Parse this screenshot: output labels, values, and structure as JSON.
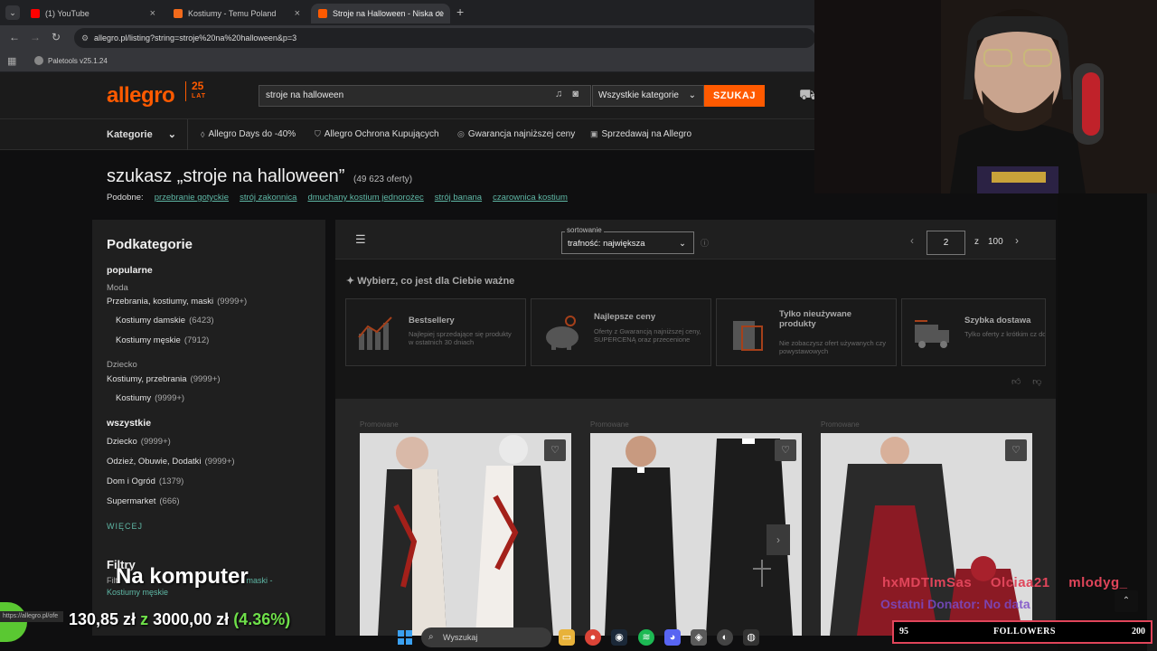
{
  "browser": {
    "tabs": [
      {
        "label": "(1) YouTube"
      },
      {
        "label": "Kostiumy - Temu Poland"
      },
      {
        "label": "Stroje na Halloween - Niska ce"
      }
    ],
    "url": "allegro.pl/listing?string=stroje%20na%20halloween&p=3",
    "bookmark": "Paletools v25.1.24"
  },
  "header": {
    "logo": "allegro",
    "logo_badge_num": "25",
    "logo_badge_text": "LAT",
    "search_value": "stroje na halloween",
    "category": "Wszystkie kategorie",
    "search_button": "SZUKAJ"
  },
  "subnav": {
    "categories": "Kategorie",
    "links": [
      "Allegro Days do -40%",
      "Allegro Ochrona Kupujących",
      "Gwarancja najniższej ceny",
      "Sprzedawaj na Allegro"
    ]
  },
  "listing": {
    "title": "szukasz „stroje na halloween”",
    "count": "(49 623 oferty)",
    "similar_label": "Podobne:",
    "similar": [
      "przebranie gotyckie",
      "strój zakonnica",
      "dmuchany kostium jednorożec",
      "strój banana",
      "czarownica kostium"
    ]
  },
  "sidebar": {
    "title": "Podkategorie",
    "popular": "popularne",
    "group1": "Moda",
    "item1": {
      "label": "Przebrania, kostiumy, maski",
      "count": "(9999+)"
    },
    "item1a": {
      "label": "Kostiumy damskie",
      "count": "(6423)"
    },
    "item1b": {
      "label": "Kostiumy męskie",
      "count": "(7912)"
    },
    "group2": "Dziecko",
    "item2": {
      "label": "Kostiumy, przebrania",
      "count": "(9999+)"
    },
    "item2a": {
      "label": "Kostiumy",
      "count": "(9999+)"
    },
    "all": "wszystkie",
    "all_items": [
      {
        "label": "Dziecko",
        "count": "(9999+)"
      },
      {
        "label": "Odzież, Obuwie, Dodatki",
        "count": "(9999+)"
      },
      {
        "label": "Dom i Ogród",
        "count": "(1379)"
      },
      {
        "label": "Supermarket",
        "count": "(666)"
      }
    ],
    "more": "WIĘCEJ",
    "filters": "Filtry",
    "filter_line": "Filt",
    "filter_line_link": "maski -",
    "filter_link": "Kostiumy męskie"
  },
  "toolbar": {
    "sort_label": "sortowanie",
    "sort_value": "trafność: największa",
    "page": "2",
    "page_of": "z",
    "page_total": "100"
  },
  "features": {
    "heading": "Wybierz, co jest dla Ciebie ważne",
    "cards": [
      {
        "title": "Bestsellery",
        "desc": "Najlepiej sprzedające się produkty w ostatnich 30 dniach"
      },
      {
        "title": "Najlepsze ceny",
        "desc": "Oferty z Gwarancją najniższej ceny, SUPERCENĄ oraz przecenione"
      },
      {
        "title": "Tylko nieużywane produkty",
        "desc": "Nie zobaczysz ofert używanych czy powystawowych"
      },
      {
        "title": "Szybka dostawa",
        "desc": "Tylko oferty z krótkim cz dostawy"
      }
    ]
  },
  "products": {
    "promo_label": "Promowane"
  },
  "stream": {
    "overlay_title": "Na komputer",
    "goal_current": "130,85 zł",
    "goal_z": "z",
    "goal_target": "3000,00 zł",
    "goal_pct": "(4.36%)",
    "donors": [
      "hxMDTImSas",
      "Olciaa21",
      "mlodyg_"
    ],
    "last_donator": "Ostatni Donator: No data",
    "followers_current": "95",
    "followers_label": "FOLLOWERS",
    "followers_goal": "200",
    "status_url": "https://allegro.pl/ofe"
  },
  "taskbar": {
    "search": "Wyszukaj"
  },
  "colors": {
    "allegro_orange": "#ff5a00",
    "link_teal": "#5fb8a6",
    "goal_green": "#6fe04a",
    "donor_red": "#e0455a"
  }
}
